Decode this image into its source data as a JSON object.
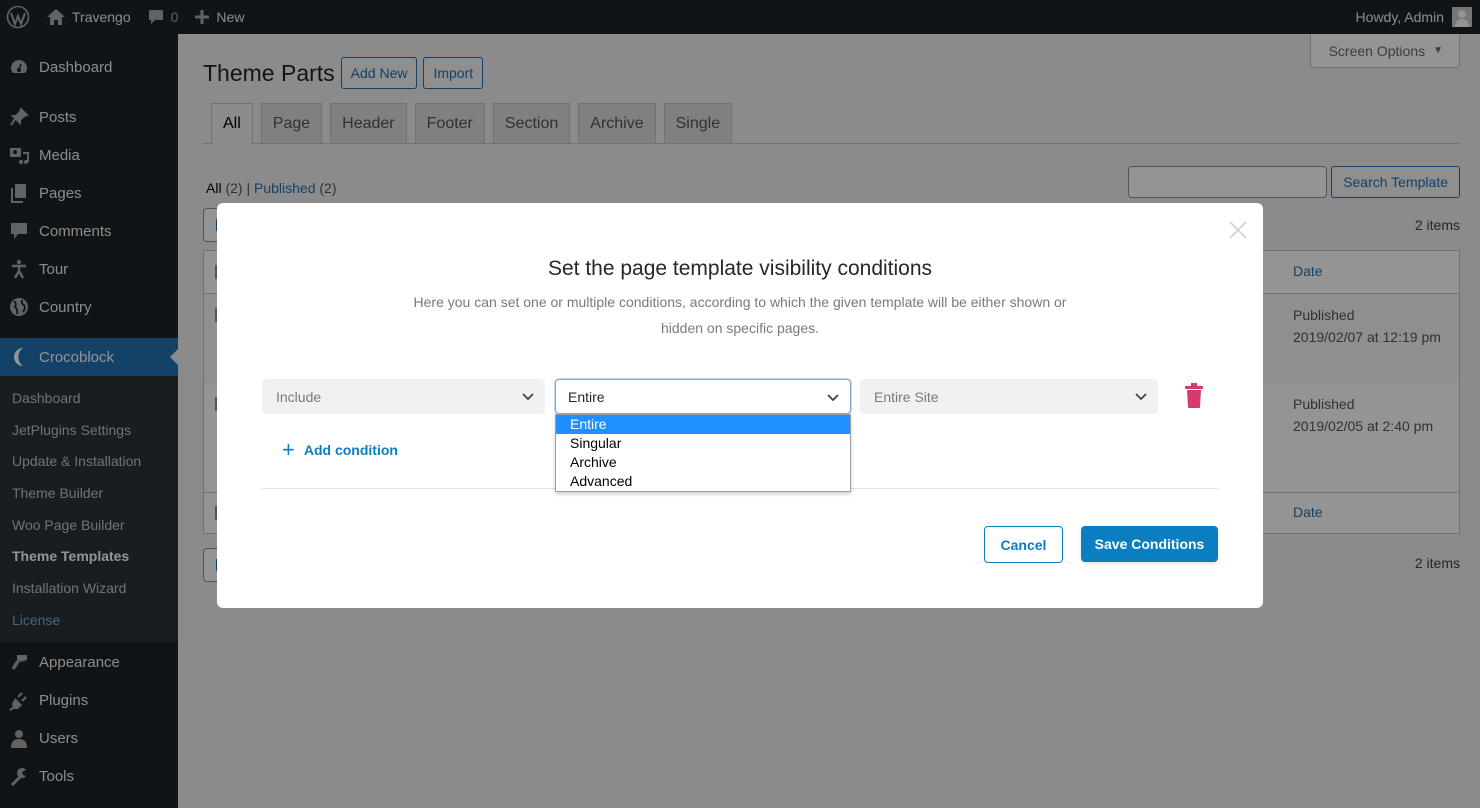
{
  "adminbar": {
    "site_name": "Travengo",
    "comments_count": "0",
    "new_label": "New",
    "greeting": "Howdy, Admin"
  },
  "sidebar": {
    "items_top": [
      {
        "label": "Dashboard",
        "icon": "dashboard-icon"
      },
      {
        "label": "Posts",
        "icon": "pin-icon"
      },
      {
        "label": "Media",
        "icon": "media-icon"
      },
      {
        "label": "Pages",
        "icon": "pages-icon"
      },
      {
        "label": "Comments",
        "icon": "comment-icon"
      },
      {
        "label": "Tour",
        "icon": "person-icon"
      },
      {
        "label": "Country",
        "icon": "globe-icon"
      }
    ],
    "active": {
      "label": "Crocoblock",
      "icon": "crocoblock-icon"
    },
    "submenu": [
      "Dashboard",
      "JetPlugins Settings",
      "Update & Installation",
      "Theme Builder",
      "Woo Page Builder",
      "Theme Templates",
      "Installation Wizard",
      "License"
    ],
    "items_bottom": [
      {
        "label": "Appearance",
        "icon": "paintbrush-icon"
      },
      {
        "label": "Plugins",
        "icon": "plugin-icon"
      },
      {
        "label": "Users",
        "icon": "user-icon"
      },
      {
        "label": "Tools",
        "icon": "wrench-icon"
      }
    ]
  },
  "main": {
    "screen_options": "Screen Options",
    "page_title": "Theme Parts",
    "add_new": "Add New",
    "import": "Import",
    "tabs": [
      "All",
      "Page",
      "Header",
      "Footer",
      "Section",
      "Archive",
      "Single"
    ],
    "active_tab": "All",
    "filter": {
      "all_label": "All",
      "all_count": "(2)",
      "separator": "|",
      "published_label": "Published",
      "published_count": "(2)"
    },
    "search_button": "Search Template",
    "search_value": "",
    "items_count": "2 items",
    "table": {
      "date_header": "Date",
      "rows": [
        {
          "status": "Published",
          "date": "2019/02/07 at 12:19 pm"
        },
        {
          "status": "Published",
          "date": "2019/02/05 at 2:40 pm"
        }
      ]
    }
  },
  "modal": {
    "title": "Set the page template visibility conditions",
    "description": "Here you can set one or multiple conditions, according to which the given template will be either shown or hidden on specific pages.",
    "condition": {
      "type_value": "Include",
      "group_value": "Entire",
      "sub_value": "Entire Site"
    },
    "dropdown_options": [
      "Entire",
      "Singular",
      "Archive",
      "Advanced"
    ],
    "dropdown_selected": "Entire",
    "add_condition": "Add condition",
    "cancel": "Cancel",
    "save": "Save Conditions",
    "colors": {
      "accent": "#0b7ec1",
      "trash": "#d63a6a",
      "option_highlight": "#1e90ff"
    }
  }
}
